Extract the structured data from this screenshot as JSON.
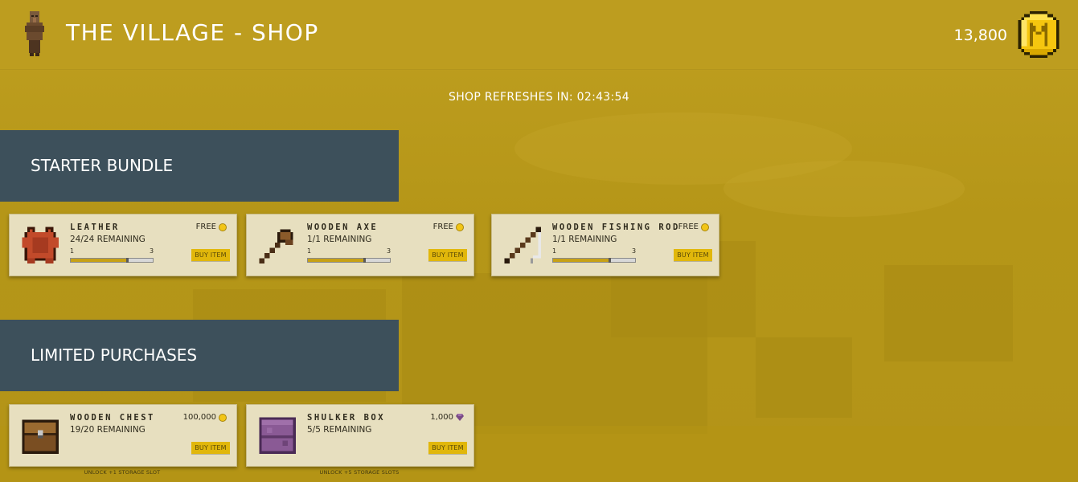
{
  "colors": {
    "accent": "#e1b70b",
    "section_bg": "#3d505b",
    "card_bg": "#e7dfbf",
    "page_bg": "#b89a1c"
  },
  "header": {
    "title": "THE VILLAGE - SHOP",
    "balance": "13,800",
    "avatar_icon": "villager-icon",
    "currency_icon": "gold-coin-icon"
  },
  "refresh": {
    "label": "SHOP REFRESHES IN:",
    "time": "02:43:54"
  },
  "sections": [
    {
      "title": "STARTER BUNDLE",
      "items": [
        {
          "name": "LEATHER",
          "remaining": "24/24 REMAINING",
          "price": "FREE",
          "price_icon": "coin-icon",
          "buy_label": "BUY ITEM",
          "slider_min": "1",
          "slider_max": "3",
          "slider_level": 0.7,
          "icon": "leather-icon"
        },
        {
          "name": "WOODEN AXE",
          "remaining": "1/1 REMAINING",
          "price": "FREE",
          "price_icon": "coin-icon",
          "buy_label": "BUY ITEM",
          "slider_min": "1",
          "slider_max": "3",
          "slider_level": 0.7,
          "icon": "wooden-axe-icon"
        },
        {
          "name": "WOODEN FISHING ROD",
          "remaining": "1/1 REMAINING",
          "price": "FREE",
          "price_icon": "coin-icon",
          "buy_label": "BUY ITEM",
          "slider_min": "1",
          "slider_max": "3",
          "slider_level": 0.7,
          "icon": "fishing-rod-icon"
        }
      ]
    },
    {
      "title": "LIMITED PURCHASES",
      "items": [
        {
          "name": "WOODEN CHEST",
          "remaining": "19/20 REMAINING",
          "price": "100,000",
          "price_icon": "coin-icon",
          "buy_label": "BUY ITEM",
          "unlock_note": "UNLOCK +1 STORAGE SLOT",
          "icon": "wooden-chest-icon"
        },
        {
          "name": "SHULKER BOX",
          "remaining": "5/5 REMAINING",
          "price": "1,000",
          "price_icon": "gem-icon",
          "buy_label": "BUY ITEM",
          "unlock_note": "UNLOCK +5 STORAGE SLOTS",
          "icon": "shulker-box-icon"
        }
      ]
    }
  ]
}
